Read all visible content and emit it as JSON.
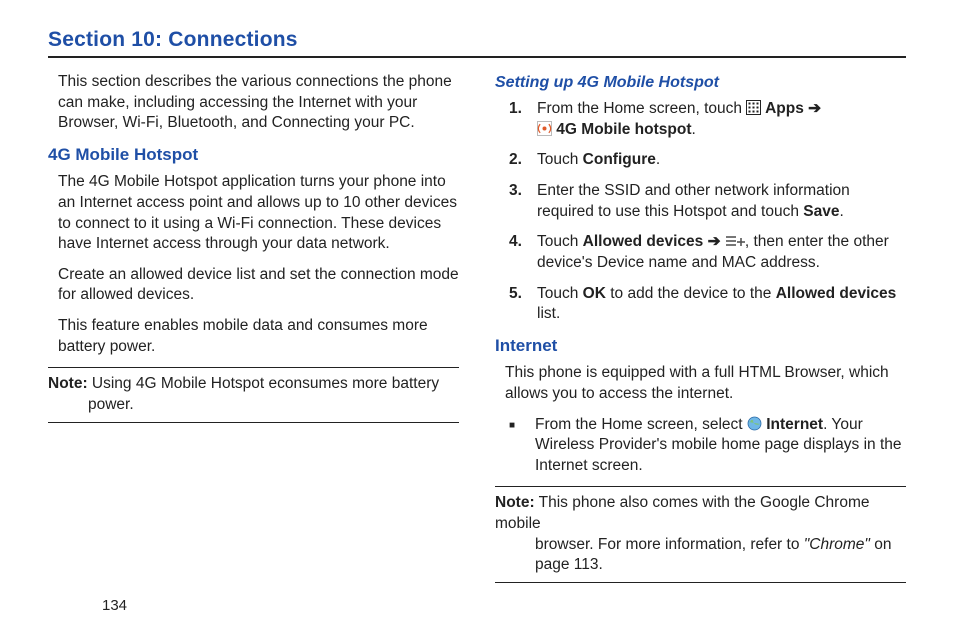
{
  "section_title": "Section 10: Connections",
  "page_number": "134",
  "left": {
    "intro": "This section describes the various connections the phone can make, including accessing the Internet with your Browser, Wi-Fi, Bluetooth, and Connecting your PC.",
    "h_hotspot": "4G Mobile Hotspot",
    "hotspot_p1": "The 4G Mobile Hotspot application turns your phone into an Internet access point and allows up to 10 other devices to connect to it using a Wi-Fi connection. These devices have Internet access through your data network.",
    "hotspot_p2": "Create an allowed device list and set the connection mode for allowed devices.",
    "hotspot_p3": "This feature enables mobile data and consumes more battery power.",
    "note_label": "Note:",
    "note_text_lead": " Using 4G Mobile Hotspot econsumes more battery",
    "note_text_cont": "power."
  },
  "right": {
    "h_setup": "Setting up 4G Mobile Hotspot",
    "steps": [
      {
        "num": "1.",
        "lead": "From the Home screen, touch ",
        "apps_bold": " Apps ",
        "arrow": "➔",
        "cont_bold": " 4G Mobile hotspot",
        "tail": "."
      },
      {
        "num": "2.",
        "lead": "Touch ",
        "bold": "Configure",
        "tail": "."
      },
      {
        "num": "3.",
        "lead": "Enter the SSID and other network information required to use this Hotspot and touch ",
        "bold": "Save",
        "tail": "."
      },
      {
        "num": "4.",
        "lead": "Touch ",
        "bold": "Allowed devices ",
        "arrow": "➔ ",
        "tail2": ", then enter the other device's Device name and MAC address."
      },
      {
        "num": "5.",
        "lead": "Touch ",
        "bold": "OK",
        "mid": " to add the device to the ",
        "bold2": "Allowed devices",
        "tail": " list."
      }
    ],
    "h_internet": "Internet",
    "internet_p1": "This phone is equipped with a full HTML Browser, which allows you to access the internet.",
    "internet_bullet_lead": "From the Home screen, select ",
    "internet_bullet_bold": " Internet",
    "internet_bullet_tail": ". Your Wireless Provider's mobile home page displays in the Internet screen.",
    "note_label": "Note:",
    "note_text_lead": " This phone also comes with the Google Chrome mobile",
    "note_cont1": "browser. For more information, refer to ",
    "note_ital": "\"Chrome\" ",
    "note_cont2": "on",
    "note_cont3": "page 113."
  }
}
